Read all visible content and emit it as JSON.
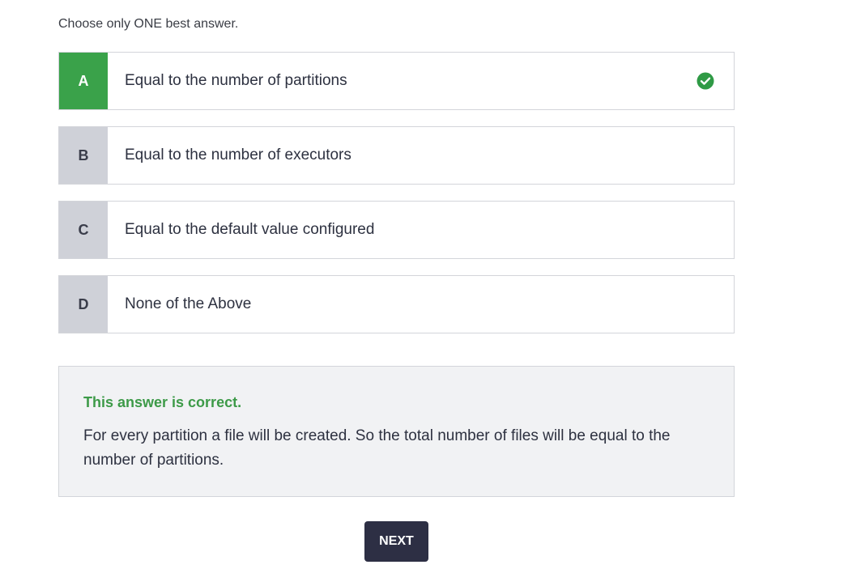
{
  "instruction": "Choose only ONE best answer.",
  "options": [
    {
      "letter": "A",
      "text": "Equal to the number of partitions",
      "correct": true
    },
    {
      "letter": "B",
      "text": "Equal to the number of executors",
      "correct": false
    },
    {
      "letter": "C",
      "text": "Equal to the default value configured",
      "correct": false
    },
    {
      "letter": "D",
      "text": "None of the Above",
      "correct": false
    }
  ],
  "feedback": {
    "verdict": "This answer is correct.",
    "explanation": "For every partition a file will be created. So the total number of files will be equal to the number of partitions."
  },
  "next_button": {
    "label": "NEXT"
  },
  "colors": {
    "correct_green": "#3aa24a",
    "letter_grey": "#cfd1d8",
    "button_dark": "#2d2f44",
    "feedback_bg": "#f1f2f4"
  },
  "icons": {
    "correct_indicator": "check-circle-icon"
  }
}
